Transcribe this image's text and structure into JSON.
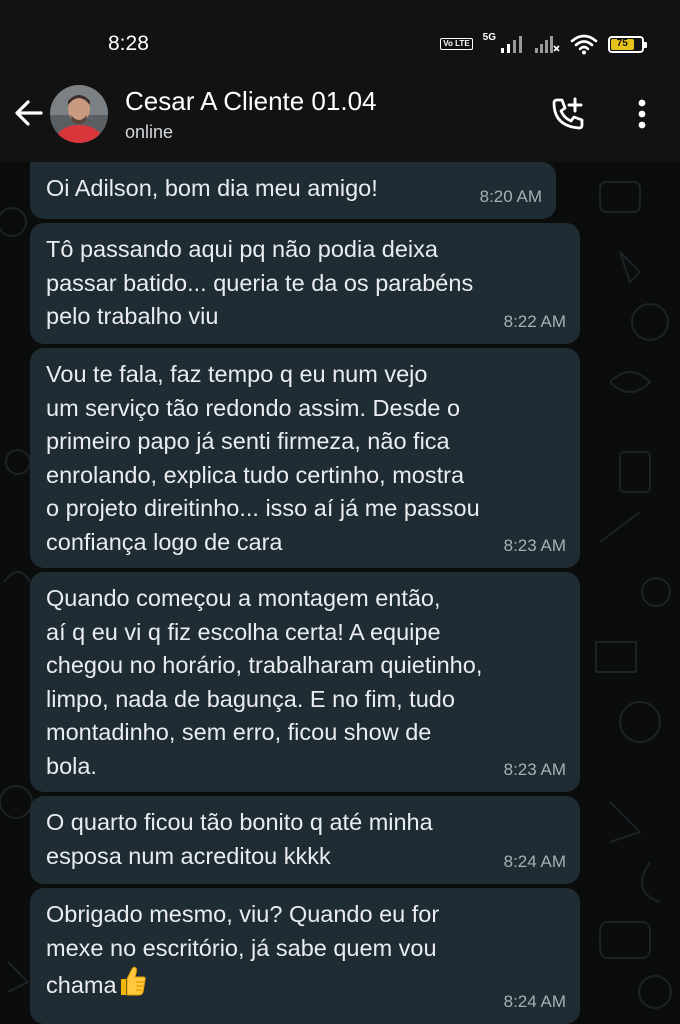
{
  "status_bar": {
    "time": "8:28",
    "volte_label": "Vo LTE",
    "network_label": "5G",
    "battery_level": "75",
    "icons": [
      "volte-icon",
      "signal-icon",
      "signal-weak-icon",
      "wifi-icon",
      "battery-icon"
    ]
  },
  "header": {
    "contact_name": "Cesar A Cliente 01.04",
    "contact_status": "online",
    "icons": [
      "back-arrow-icon",
      "add-call-icon",
      "more-vertical-icon"
    ]
  },
  "messages": [
    {
      "text": "Oi Adilson, bom dia meu amigo!",
      "time": "8:20 AM"
    },
    {
      "text": "Tô passando aqui pq não podia deixa\npassar batido... queria te da os parabéns\npelo trabalho viu",
      "time": "8:22 AM"
    },
    {
      "text": "Vou te fala, faz tempo q eu num vejo\num serviço tão redondo assim. Desde o\nprimeiro papo já senti firmeza, não fica\nenrolando, explica tudo certinho, mostra\no projeto direitinho... isso aí já me passou\nconfiança logo de cara",
      "time": "8:23 AM"
    },
    {
      "text": "Quando começou a montagem então,\naí q eu vi q fiz escolha certa! A equipe\nchegou no horário, trabalharam quietinho,\nlimpo, nada de bagunça. E no fim, tudo\nmontadinho, sem erro, ficou show de\nbola.",
      "time": "8:23 AM"
    },
    {
      "text": "O quarto ficou tão bonito q até minha\nesposa num acreditou kkkk",
      "time": "8:24 AM"
    },
    {
      "text": "Obrigado mesmo, viu? Quando eu for\nmexe no escritório, já sabe quem vou\nchama",
      "time": "8:24 AM",
      "emoji": "thumbs-up-icon"
    }
  ],
  "colors": {
    "bubble_bg": "#1f2c33",
    "header_bg": "#121212",
    "chat_bg": "#0b0d0d",
    "text": "#e9edef",
    "timestamp": "#a5b0b6",
    "battery": "#e7c21b"
  }
}
